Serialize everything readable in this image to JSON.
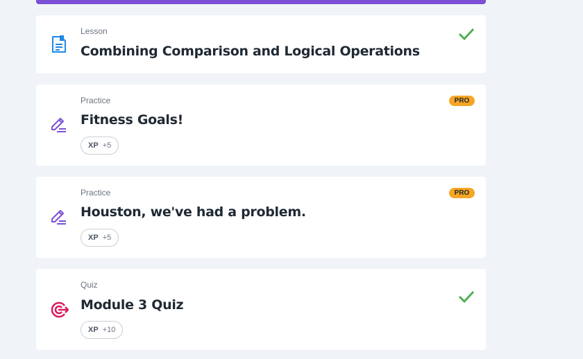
{
  "colors": {
    "accent": "#7b4fd6",
    "pro": "#f5a623",
    "check": "#4caf50",
    "lesson_icon": "#1e88e5",
    "practice_icon": "#7b4fd6",
    "quiz_icon": "#d81b60"
  },
  "course_progress": 1,
  "items": [
    {
      "type": "Lesson",
      "title": "Combining Comparison and Logical Operations",
      "icon": "lesson-document-icon",
      "status": "completed"
    },
    {
      "type": "Practice",
      "title": "Fitness Goals!",
      "icon": "practice-pencil-icon",
      "badge": "PRO",
      "xp_label": "XP",
      "xp_value": "+5"
    },
    {
      "type": "Practice",
      "title": "Houston, we've had a problem.",
      "icon": "practice-pencil-icon",
      "badge": "PRO",
      "xp_label": "XP",
      "xp_value": "+5"
    },
    {
      "type": "Quiz",
      "title": "Module 3 Quiz",
      "icon": "quiz-target-icon",
      "status": "completed",
      "xp_label": "XP",
      "xp_value": "+10"
    }
  ]
}
